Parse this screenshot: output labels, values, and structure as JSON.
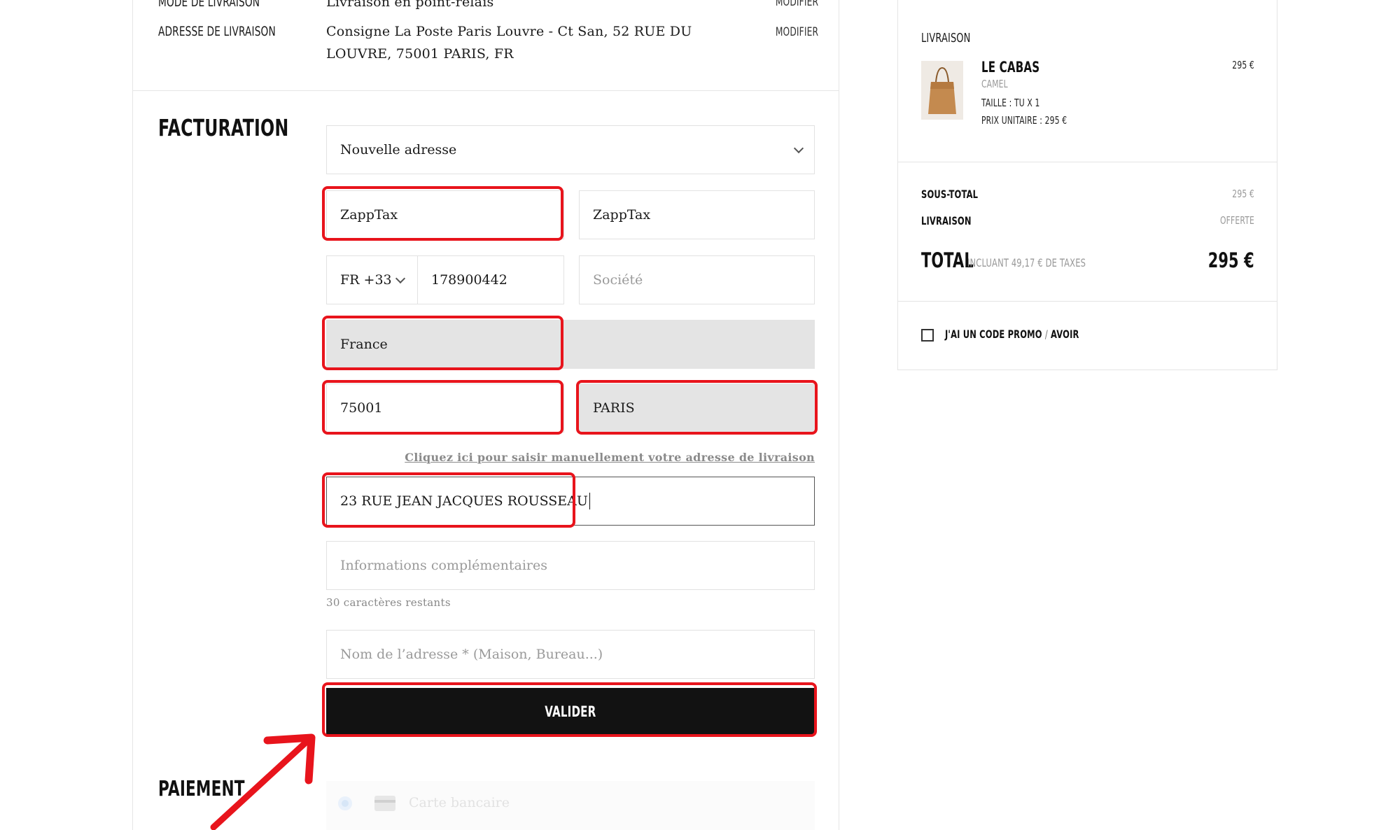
{
  "delivery": {
    "mode_label": "MODE DE LIVRAISON",
    "mode_value": "Livraison en point-relais",
    "mode_modify": "MODIFIER",
    "address_label": "ADRESSE DE LIVRAISON",
    "address_line1": "Consigne La Poste Paris Louvre - Ct San, 52 RUE DU",
    "address_line2": "LOUVRE, 75001 PARIS, FR",
    "address_modify": "MODIFIER"
  },
  "billing": {
    "title": "FACTURATION",
    "address_select": "Nouvelle adresse",
    "first_name": "ZappTax",
    "last_name": "ZappTax",
    "phone_prefix": "FR +33",
    "phone": "178900442",
    "company_placeholder": "Société",
    "country": "France",
    "postal_code": "75001",
    "city": "PARIS",
    "manual_link": "Cliquez ici pour saisir manuellement votre adresse de livraison",
    "street": "23 RUE JEAN JACQUES ROUSSEAU",
    "extra_placeholder": "Informations complémentaires",
    "chars_remaining": "30 caractères restants",
    "address_name_placeholder": "Nom de l’adresse * (Maison, Bureau...)",
    "submit_label": "VALIDER"
  },
  "payment": {
    "title": "PAIEMENT",
    "option_card": "Carte bancaire"
  },
  "summary": {
    "delivery_title": "LIVRAISON",
    "product_name": "LE CABAS",
    "product_color": "CAMEL",
    "product_size": "TAILLE : TU X 1",
    "product_unit_price": "PRIX UNITAIRE : 295 €",
    "product_price": "295 €",
    "subtotal_label": "SOUS-TOTAL",
    "subtotal_value": "295 €",
    "shipping_label": "LIVRAISON",
    "shipping_value": "OFFERTE",
    "total_label": "TOTAL",
    "total_tax_note": "INCLUANT 49,17 € DE TAXES",
    "total_value": "295 €",
    "promo_part1": "J'AI UN CODE PROMO",
    "promo_sep": "/",
    "promo_part2": "AVOIR"
  },
  "colors": {
    "highlight": "#e8141c",
    "button_bg": "#121212",
    "field_grey": "#e4e4e4"
  }
}
